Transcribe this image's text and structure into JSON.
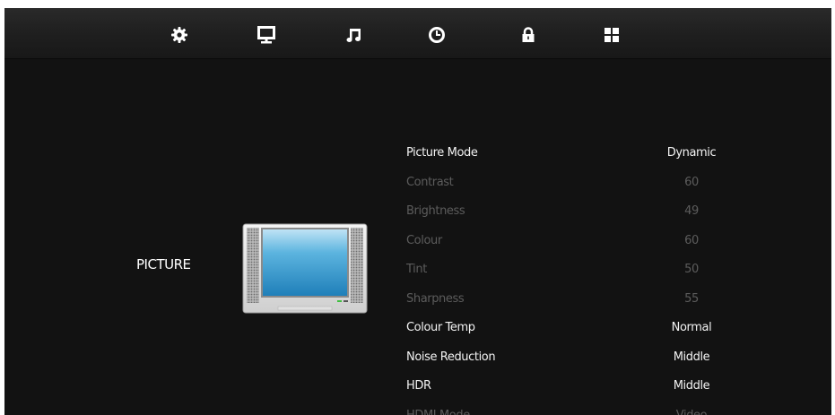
{
  "tabs": [
    {
      "id": "setup",
      "icon": "gear-icon",
      "active": false
    },
    {
      "id": "picture",
      "icon": "monitor-icon",
      "active": true
    },
    {
      "id": "sound",
      "icon": "music-note-icon",
      "active": false
    },
    {
      "id": "time",
      "icon": "clock-icon",
      "active": false
    },
    {
      "id": "lock",
      "icon": "padlock-icon",
      "active": false
    },
    {
      "id": "app",
      "icon": "grid-icon",
      "active": false
    }
  ],
  "section": {
    "title": "PICTURE",
    "illustration": "tv-icon"
  },
  "menu": {
    "items": [
      {
        "label": "Picture Mode",
        "value": "Dynamic",
        "enabled": true
      },
      {
        "label": "Contrast",
        "value": "60",
        "enabled": false
      },
      {
        "label": "Brightness",
        "value": "49",
        "enabled": false
      },
      {
        "label": "Colour",
        "value": "60",
        "enabled": false
      },
      {
        "label": "Tint",
        "value": "50",
        "enabled": false
      },
      {
        "label": "Sharpness",
        "value": "55",
        "enabled": false
      },
      {
        "label": "Colour Temp",
        "value": "Normal",
        "enabled": true
      },
      {
        "label": "Noise Reduction",
        "value": "Middle",
        "enabled": true
      },
      {
        "label": "HDR",
        "value": "Middle",
        "enabled": true
      },
      {
        "label": "HDMI Mode",
        "value": "Video",
        "enabled": false
      }
    ]
  },
  "colors": {
    "background": "#121212",
    "text_enabled": "#f2f2f2",
    "text_disabled": "#5c5c5c",
    "icon": "#ffffff"
  }
}
